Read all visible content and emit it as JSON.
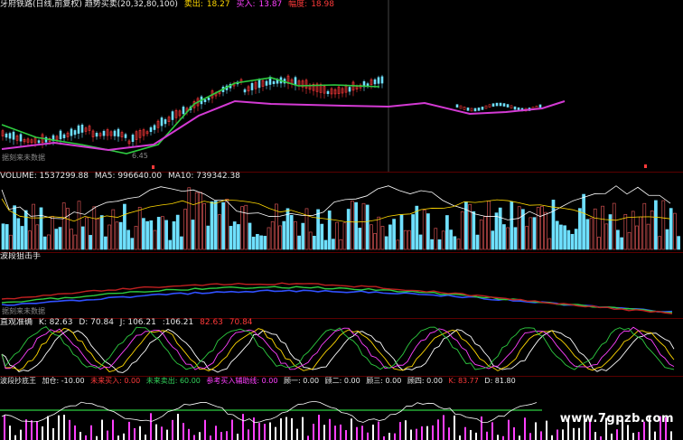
{
  "main": {
    "title": "牙府铁路(日线,前复权) 趋势买卖(20,32,80,100)",
    "sell_label": "卖出:",
    "sell_value": "18.27",
    "buy_label": "买入:",
    "buy_value": "13.87",
    "amp_label": "幅度:",
    "amp_value": "18.98",
    "low_price": "6.45",
    "unit_note": "据刻来未数据"
  },
  "volume": {
    "title": "VOLUME: 1537299.88",
    "ma5": "MA5: 996640.00",
    "ma10": "MA10: 739342.38"
  },
  "macd": {
    "title": "波段狙击手",
    "note": "据刻来未数据"
  },
  "kdj": {
    "title": "直观准确",
    "k": "K: 82.63",
    "d": "D: 70.84",
    "j": "J: 106.21",
    "extra1": ":106.21",
    "extra2": "82.63",
    "extra3": "70.84"
  },
  "bottom": {
    "title": "波段抄底王",
    "add": "加仓: -10.00",
    "buy1": "未来买入: 0.00",
    "sell1": "未来卖出: 60.00",
    "ref": "参考买入辅助线: 0.00",
    "s1": "顾一: 0.00",
    "s2": "顾二: 0.00",
    "s3": "顾三: 0.00",
    "s4": "顾四: 0.00",
    "k": "K: 83.77",
    "d": "D: 81.80"
  },
  "watermark": "www.7gpzb.com",
  "colors": {
    "up": "#ff3a3a",
    "down": "#6fe0ff",
    "ma_green": "#2ecc40",
    "ma_magenta": "#d33ad3",
    "grid": "#5a0000"
  }
}
